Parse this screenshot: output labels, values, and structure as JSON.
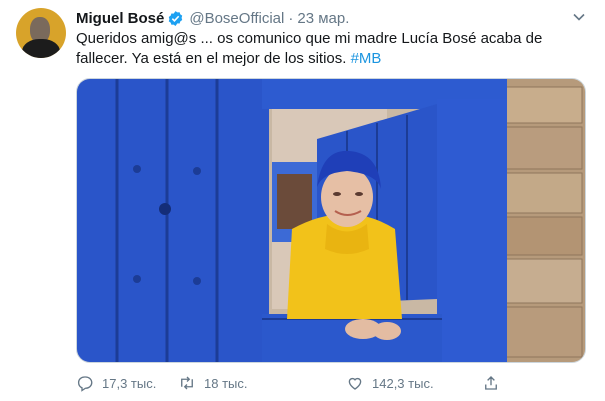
{
  "tweet": {
    "author_name": "Miguel Bosé",
    "handle": "@BoseOfficial",
    "separator": "·",
    "time": "23 мар.",
    "text_before": "Queridos amig@s ... os comunico que mi madre Lucía Bosé acaba de fallecer. Ya está en el mejor de los sitios. ",
    "hashtag": "#MB"
  },
  "actions": {
    "replies": "17,3 тыс.",
    "retweets": "18 тыс.",
    "likes": "142,3 тыс."
  },
  "icons": [
    "verified-badge-icon",
    "chevron-down-icon",
    "reply-icon",
    "retweet-icon",
    "like-icon",
    "share-icon"
  ],
  "colors": {
    "link": "#1b95e0",
    "muted": "#657786",
    "verified": "#1da1f2",
    "door_blue": "#2a55c9",
    "sweater_yellow": "#f2c21a"
  }
}
